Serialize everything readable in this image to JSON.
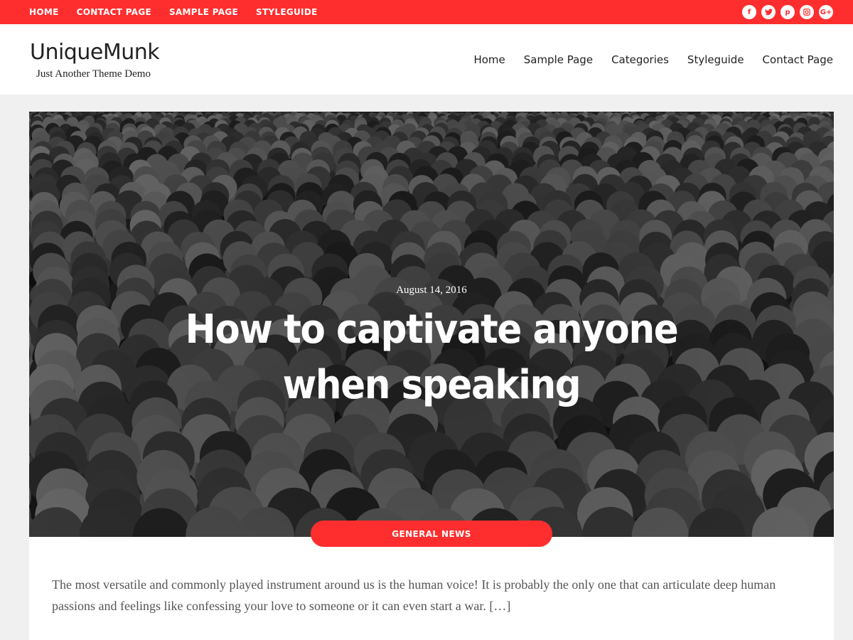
{
  "topbar": {
    "nav": [
      "HOME",
      "CONTACT PAGE",
      "SAMPLE PAGE",
      "STYLEGUIDE"
    ],
    "social": [
      {
        "icon": "facebook-icon",
        "glyph": "f"
      },
      {
        "icon": "twitter-icon",
        "glyph": "t"
      },
      {
        "icon": "pinterest-icon",
        "glyph": "p"
      },
      {
        "icon": "instagram-icon",
        "glyph": "◘"
      },
      {
        "icon": "google-plus-icon",
        "glyph": "G+"
      }
    ],
    "color": "#ff2e2e"
  },
  "header": {
    "title": "UniqueMunk",
    "tagline": "Just Another Theme Demo",
    "nav": [
      "Home",
      "Sample Page",
      "Categories",
      "Styleguide",
      "Contact Page"
    ]
  },
  "post": {
    "date": "August 14, 2016",
    "title": "How to captivate anyone when speaking",
    "category": "GENERAL NEWS",
    "excerpt": "The most versatile and commonly played instrument around us is the human voice! It is probably the only one that can articulate deep human passions and feelings like confessing your love to someone or it can even start a war. […]"
  }
}
